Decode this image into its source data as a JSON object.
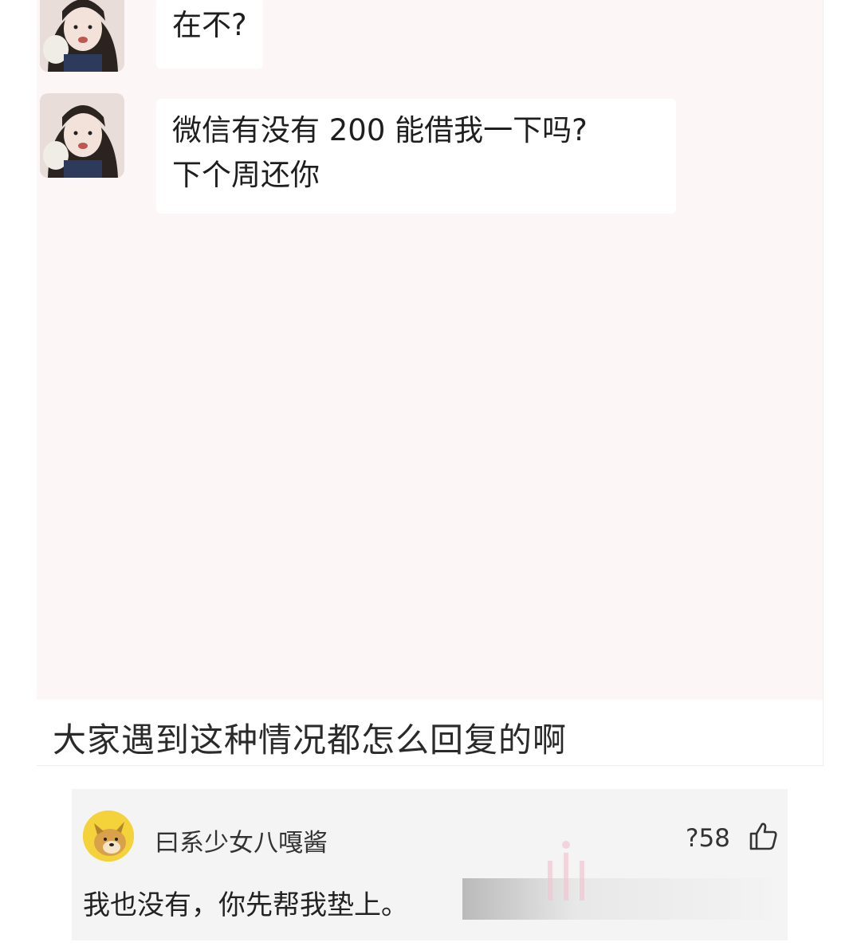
{
  "chat": {
    "messages": [
      {
        "lines": [
          "在不?"
        ]
      },
      {
        "lines": [
          "微信有没有 200 能借我一下吗?",
          "下个周还你"
        ]
      }
    ]
  },
  "post": {
    "caption": "大家遇到这种情况都怎么回复的啊"
  },
  "comment": {
    "author": "曰系少女八嘎酱",
    "likes": "?58",
    "text": "我也没有，你先帮我垫上。"
  },
  "colors": {
    "chat_background": "#fdf6f6",
    "bubble": "#ffffff",
    "comment_background": "#f4f4f4",
    "commenter_avatar": "#f3d23a"
  },
  "icons": [
    "girl-avatar-icon",
    "dog-avatar-icon",
    "thumbs-up-icon"
  ]
}
